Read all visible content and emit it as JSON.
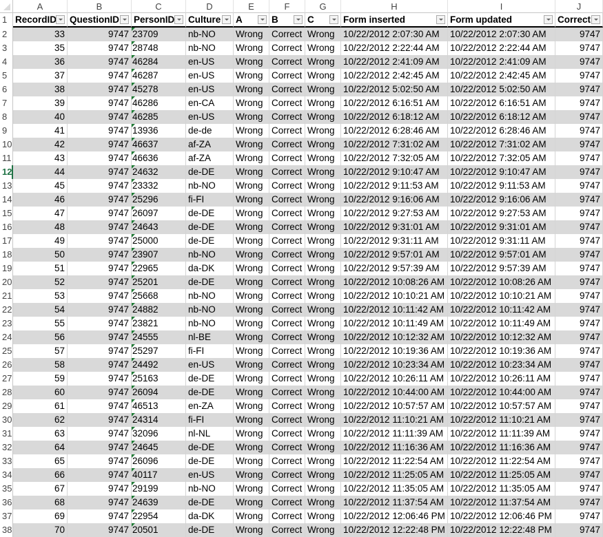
{
  "sheet": {
    "column_letters": [
      "A",
      "B",
      "C",
      "D",
      "E",
      "F",
      "G",
      "H",
      "I",
      "J"
    ],
    "headers": [
      "RecordID",
      "QuestionID",
      "PersonID",
      "Culture",
      "A",
      "B",
      "C",
      "Form inserted",
      "Form updated",
      "Correct"
    ],
    "active_row": "12",
    "filter_icon": "dropdown-arrow",
    "error_indicator_color": "#1e7b34",
    "band_color": "#d9d9d9",
    "rows": [
      {
        "n": "2",
        "cells": [
          "33",
          "9747",
          "23709",
          "nb-NO",
          "Wrong",
          "Correct",
          "Wrong",
          "10/22/2012 2:07:30 AM",
          "10/22/2012 2:07:30 AM",
          "9747"
        ]
      },
      {
        "n": "3",
        "cells": [
          "35",
          "9747",
          "28748",
          "nb-NO",
          "Wrong",
          "Correct",
          "Wrong",
          "10/22/2012 2:22:44 AM",
          "10/22/2012 2:22:44 AM",
          "9747"
        ]
      },
      {
        "n": "4",
        "cells": [
          "36",
          "9747",
          "46284",
          "en-US",
          "Wrong",
          "Correct",
          "Wrong",
          "10/22/2012 2:41:09 AM",
          "10/22/2012 2:41:09 AM",
          "9747"
        ]
      },
      {
        "n": "5",
        "cells": [
          "37",
          "9747",
          "46287",
          "en-US",
          "Wrong",
          "Correct",
          "Wrong",
          "10/22/2012 2:42:45 AM",
          "10/22/2012 2:42:45 AM",
          "9747"
        ]
      },
      {
        "n": "6",
        "cells": [
          "38",
          "9747",
          "45278",
          "en-US",
          "Wrong",
          "Correct",
          "Wrong",
          "10/22/2012 5:02:50 AM",
          "10/22/2012 5:02:50 AM",
          "9747"
        ]
      },
      {
        "n": "7",
        "cells": [
          "39",
          "9747",
          "46286",
          "en-CA",
          "Wrong",
          "Correct",
          "Wrong",
          "10/22/2012 6:16:51 AM",
          "10/22/2012 6:16:51 AM",
          "9747"
        ]
      },
      {
        "n": "8",
        "cells": [
          "40",
          "9747",
          "46285",
          "en-US",
          "Wrong",
          "Correct",
          "Wrong",
          "10/22/2012 6:18:12 AM",
          "10/22/2012 6:18:12 AM",
          "9747"
        ]
      },
      {
        "n": "9",
        "cells": [
          "41",
          "9747",
          "13936",
          "de-de",
          "Wrong",
          "Correct",
          "Wrong",
          "10/22/2012 6:28:46 AM",
          "10/22/2012 6:28:46 AM",
          "9747"
        ]
      },
      {
        "n": "10",
        "cells": [
          "42",
          "9747",
          "46637",
          "af-ZA",
          "Wrong",
          "Correct",
          "Wrong",
          "10/22/2012 7:31:02 AM",
          "10/22/2012 7:31:02 AM",
          "9747"
        ]
      },
      {
        "n": "11",
        "cells": [
          "43",
          "9747",
          "46636",
          "af-ZA",
          "Wrong",
          "Correct",
          "Wrong",
          "10/22/2012 7:32:05 AM",
          "10/22/2012 7:32:05 AM",
          "9747"
        ]
      },
      {
        "n": "12",
        "cells": [
          "44",
          "9747",
          "24632",
          "de-DE",
          "Wrong",
          "Correct",
          "Wrong",
          "10/22/2012 9:10:47 AM",
          "10/22/2012 9:10:47 AM",
          "9747"
        ]
      },
      {
        "n": "13",
        "cells": [
          "45",
          "9747",
          "23332",
          "nb-NO",
          "Wrong",
          "Correct",
          "Wrong",
          "10/22/2012 9:11:53 AM",
          "10/22/2012 9:11:53 AM",
          "9747"
        ]
      },
      {
        "n": "14",
        "cells": [
          "46",
          "9747",
          "25296",
          "fi-FI",
          "Wrong",
          "Correct",
          "Wrong",
          "10/22/2012 9:16:06 AM",
          "10/22/2012 9:16:06 AM",
          "9747"
        ]
      },
      {
        "n": "15",
        "cells": [
          "47",
          "9747",
          "26097",
          "de-DE",
          "Wrong",
          "Correct",
          "Wrong",
          "10/22/2012 9:27:53 AM",
          "10/22/2012 9:27:53 AM",
          "9747"
        ]
      },
      {
        "n": "16",
        "cells": [
          "48",
          "9747",
          "24643",
          "de-DE",
          "Wrong",
          "Correct",
          "Wrong",
          "10/22/2012 9:31:01 AM",
          "10/22/2012 9:31:01 AM",
          "9747"
        ]
      },
      {
        "n": "17",
        "cells": [
          "49",
          "9747",
          "25000",
          "de-DE",
          "Wrong",
          "Correct",
          "Wrong",
          "10/22/2012 9:31:11 AM",
          "10/22/2012 9:31:11 AM",
          "9747"
        ]
      },
      {
        "n": "18",
        "cells": [
          "50",
          "9747",
          "23907",
          "nb-NO",
          "Wrong",
          "Correct",
          "Wrong",
          "10/22/2012 9:57:01 AM",
          "10/22/2012 9:57:01 AM",
          "9747"
        ]
      },
      {
        "n": "19",
        "cells": [
          "51",
          "9747",
          "22965",
          "da-DK",
          "Wrong",
          "Correct",
          "Wrong",
          "10/22/2012 9:57:39 AM",
          "10/22/2012 9:57:39 AM",
          "9747"
        ]
      },
      {
        "n": "20",
        "cells": [
          "52",
          "9747",
          "25201",
          "de-DE",
          "Wrong",
          "Correct",
          "Wrong",
          "10/22/2012 10:08:26 AM",
          "10/22/2012 10:08:26 AM",
          "9747"
        ]
      },
      {
        "n": "21",
        "cells": [
          "53",
          "9747",
          "25668",
          "nb-NO",
          "Wrong",
          "Correct",
          "Wrong",
          "10/22/2012 10:10:21 AM",
          "10/22/2012 10:10:21 AM",
          "9747"
        ]
      },
      {
        "n": "22",
        "cells": [
          "54",
          "9747",
          "24882",
          "nb-NO",
          "Wrong",
          "Correct",
          "Wrong",
          "10/22/2012 10:11:42 AM",
          "10/22/2012 10:11:42 AM",
          "9747"
        ]
      },
      {
        "n": "23",
        "cells": [
          "55",
          "9747",
          "23821",
          "nb-NO",
          "Wrong",
          "Correct",
          "Wrong",
          "10/22/2012 10:11:49 AM",
          "10/22/2012 10:11:49 AM",
          "9747"
        ]
      },
      {
        "n": "24",
        "cells": [
          "56",
          "9747",
          "24555",
          "nl-BE",
          "Wrong",
          "Correct",
          "Wrong",
          "10/22/2012 10:12:32 AM",
          "10/22/2012 10:12:32 AM",
          "9747"
        ]
      },
      {
        "n": "25",
        "cells": [
          "57",
          "9747",
          "25297",
          "fi-FI",
          "Wrong",
          "Correct",
          "Wrong",
          "10/22/2012 10:19:36 AM",
          "10/22/2012 10:19:36 AM",
          "9747"
        ]
      },
      {
        "n": "26",
        "cells": [
          "58",
          "9747",
          "24492",
          "en-US",
          "Wrong",
          "Correct",
          "Wrong",
          "10/22/2012 10:23:34 AM",
          "10/22/2012 10:23:34 AM",
          "9747"
        ]
      },
      {
        "n": "27",
        "cells": [
          "59",
          "9747",
          "25163",
          "de-DE",
          "Wrong",
          "Correct",
          "Wrong",
          "10/22/2012 10:26:11 AM",
          "10/22/2012 10:26:11 AM",
          "9747"
        ]
      },
      {
        "n": "28",
        "cells": [
          "60",
          "9747",
          "26094",
          "de-DE",
          "Wrong",
          "Correct",
          "Wrong",
          "10/22/2012 10:44:00 AM",
          "10/22/2012 10:44:00 AM",
          "9747"
        ]
      },
      {
        "n": "29",
        "cells": [
          "61",
          "9747",
          "46513",
          "en-ZA",
          "Wrong",
          "Correct",
          "Wrong",
          "10/22/2012 10:57:57 AM",
          "10/22/2012 10:57:57 AM",
          "9747"
        ]
      },
      {
        "n": "30",
        "cells": [
          "62",
          "9747",
          "24314",
          "fi-FI",
          "Wrong",
          "Correct",
          "Wrong",
          "10/22/2012 11:10:21 AM",
          "10/22/2012 11:10:21 AM",
          "9747"
        ]
      },
      {
        "n": "31",
        "cells": [
          "63",
          "9747",
          "32096",
          "nl-NL",
          "Wrong",
          "Correct",
          "Wrong",
          "10/22/2012 11:11:39 AM",
          "10/22/2012 11:11:39 AM",
          "9747"
        ]
      },
      {
        "n": "32",
        "cells": [
          "64",
          "9747",
          "24645",
          "de-DE",
          "Wrong",
          "Correct",
          "Wrong",
          "10/22/2012 11:16:36 AM",
          "10/22/2012 11:16:36 AM",
          "9747"
        ]
      },
      {
        "n": "33",
        "cells": [
          "65",
          "9747",
          "26096",
          "de-DE",
          "Wrong",
          "Correct",
          "Wrong",
          "10/22/2012 11:22:54 AM",
          "10/22/2012 11:22:54 AM",
          "9747"
        ]
      },
      {
        "n": "34",
        "cells": [
          "66",
          "9747",
          "40117",
          "en-US",
          "Wrong",
          "Correct",
          "Wrong",
          "10/22/2012 11:25:05 AM",
          "10/22/2012 11:25:05 AM",
          "9747"
        ]
      },
      {
        "n": "35",
        "cells": [
          "67",
          "9747",
          "29199",
          "nb-NO",
          "Wrong",
          "Correct",
          "Wrong",
          "10/22/2012 11:35:05 AM",
          "10/22/2012 11:35:05 AM",
          "9747"
        ]
      },
      {
        "n": "36",
        "cells": [
          "68",
          "9747",
          "24639",
          "de-DE",
          "Wrong",
          "Correct",
          "Wrong",
          "10/22/2012 11:37:54 AM",
          "10/22/2012 11:37:54 AM",
          "9747"
        ]
      },
      {
        "n": "37",
        "cells": [
          "69",
          "9747",
          "22954",
          "da-DK",
          "Wrong",
          "Correct",
          "Wrong",
          "10/22/2012 12:06:46 PM",
          "10/22/2012 12:06:46 PM",
          "9747"
        ]
      },
      {
        "n": "38",
        "cells": [
          "70",
          "9747",
          "20501",
          "de-DE",
          "Wrong",
          "Correct",
          "Wrong",
          "10/22/2012 12:22:48 PM",
          "10/22/2012 12:22:48 PM",
          "9747"
        ]
      }
    ]
  }
}
